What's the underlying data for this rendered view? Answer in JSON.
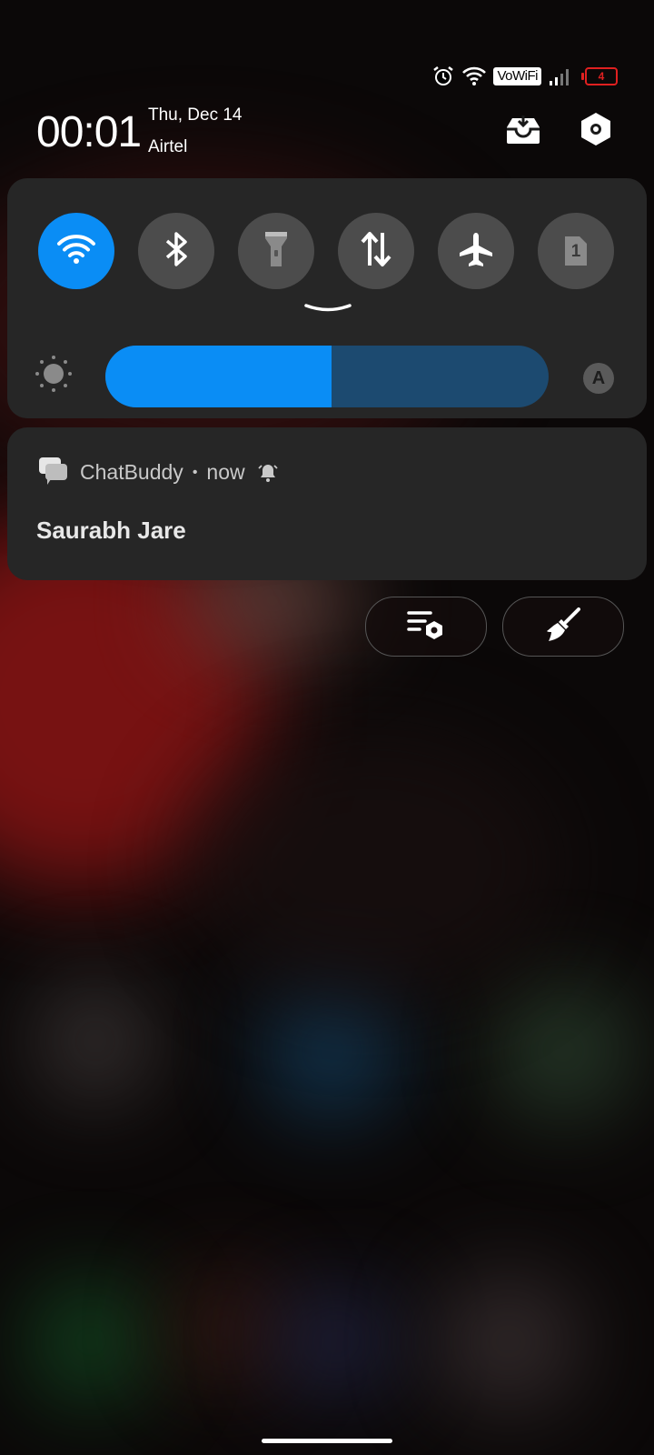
{
  "status_bar": {
    "icons": [
      "alarm-icon",
      "wifi-icon",
      "vowifi-badge",
      "cellular-signal-icon",
      "battery-icon"
    ],
    "vowifi_label": "VoWiFi",
    "battery_level": "4",
    "battery_color": "#e02020"
  },
  "header": {
    "time": "00:01",
    "date": "Thu, Dec 14",
    "carrier": "Airtel"
  },
  "quick_settings": {
    "accent_color": "#0a8df5",
    "tiles": [
      {
        "name": "wifi",
        "icon": "wifi-icon",
        "active": true
      },
      {
        "name": "bluetooth",
        "icon": "bluetooth-icon",
        "active": false
      },
      {
        "name": "flashlight",
        "icon": "flashlight-icon",
        "active": false
      },
      {
        "name": "mobile-data",
        "icon": "mobile-data-icon",
        "active": false
      },
      {
        "name": "airplane-mode",
        "icon": "airplane-icon",
        "active": false
      },
      {
        "name": "sim",
        "icon": "sim-card-icon",
        "active": false
      }
    ],
    "sim_number": "1",
    "brightness_level": 0.51,
    "auto_brightness_label": "A"
  },
  "notification": {
    "app_name": "ChatBuddy",
    "separator": "•",
    "time": "now",
    "title": "Saurabh Jare"
  }
}
